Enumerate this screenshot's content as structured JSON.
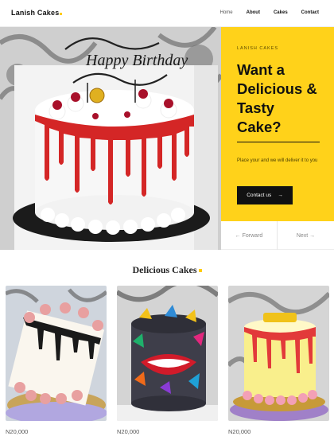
{
  "nav": {
    "brand": "Lanish Cakes",
    "links": [
      "Home",
      "About",
      "Cakes",
      "Contact"
    ]
  },
  "hero": {
    "eyebrow": "LANISH CAKES",
    "headline": "Want a Delicious & Tasty Cake?",
    "description": "Place your and we will deliver it to you",
    "cta_label": "Contact us",
    "prev_label": "Forward",
    "next_label": "Next",
    "cake_topper": "Happy Birthday"
  },
  "section": {
    "title": "Delicious Cakes"
  },
  "products": [
    {
      "price": "N20,000"
    },
    {
      "price": "N20,000"
    },
    {
      "price": "N20,000"
    }
  ],
  "colors": {
    "accent": "#ffd21a",
    "dark": "#111111",
    "drip_red": "#d42626"
  }
}
